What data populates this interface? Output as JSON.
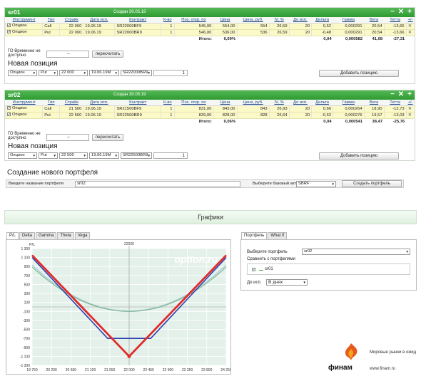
{
  "portfolios": [
    {
      "name": "sr01",
      "created": "Создан 30.05.19",
      "rows": [
        {
          "type": "Опцион",
          "kind": "Call",
          "strike": "22 000",
          "exp": "19.06.19",
          "contract": "SR22000BF9",
          "qty": "1",
          "open": "545,00",
          "price": "554,00",
          "price_rub": "554",
          "iv": "26,59",
          "days": "20",
          "delta": "0,52",
          "gamma": "0,000291",
          "vega": "20,54",
          "theta": "-13,66"
        },
        {
          "type": "Опцион",
          "kind": "Put",
          "strike": "22 000",
          "exp": "19.06.19",
          "contract": "SR22000BR9",
          "qty": "1",
          "open": "546,00",
          "price": "536,00",
          "price_rub": "536",
          "iv": "26,59",
          "days": "20",
          "delta": "-0,48",
          "gamma": "0,000291",
          "vega": "20,54",
          "theta": "-13,66"
        }
      ],
      "total": {
        "label": "Итого:",
        "pct": "0,09%",
        "delta": "0,04",
        "gamma": "0,000582",
        "vega": "41,08",
        "theta": "-27,31"
      },
      "new": {
        "type": "Опцион",
        "kind": "Put",
        "strike": "22 000",
        "exp": "19.06.19М",
        "contract": "SR22000BR9",
        "qty": "1"
      }
    },
    {
      "name": "sr02",
      "created": "Создан 30.05.19",
      "rows": [
        {
          "type": "Опцион",
          "kind": "Call",
          "strike": "21 500",
          "exp": "19.06.19",
          "contract": "SR21500BF9",
          "qty": "1",
          "open": "831,00",
          "price": "843,00",
          "price_rub": "843",
          "iv": "26,93",
          "days": "20",
          "delta": "0,66",
          "gamma": "0,000264",
          "vega": "18,90",
          "theta": "-12,73"
        },
        {
          "type": "Опцион",
          "kind": "Put",
          "strike": "22 500",
          "exp": "19.06.19",
          "contract": "SR22500BR9",
          "qty": "1",
          "open": "839,00",
          "price": "828,00",
          "price_rub": "828",
          "iv": "26,64",
          "days": "20",
          "delta": "-0,62",
          "gamma": "0,000276",
          "vega": "19,57",
          "theta": "-13,03"
        }
      ],
      "total": {
        "label": "Итого:",
        "pct": "0,06%",
        "delta": "0,04",
        "gamma": "0,000541",
        "vega": "38,47",
        "theta": "-25,76"
      },
      "new": {
        "type": "Опцион",
        "kind": "Put",
        "strike": "22 500",
        "exp": "19.06.19М",
        "contract": "SR22500BR9",
        "qty": "1"
      }
    }
  ],
  "headers": [
    "Инструмент",
    "Тип",
    "Страйк",
    "Дата исп.",
    "Контракт",
    "К-во",
    "Поз. откр. по",
    "Цена",
    "Цена, руб.",
    "IV, %",
    "До исп.",
    "Дельта",
    "Гамма",
    "Вега",
    "Тетта",
    "+/-"
  ],
  "go_label": "ГО Временно не доступно",
  "go_value": "--",
  "recalc": "пересчитать",
  "new_position": "Новая позиция",
  "add_position": "Добавить позицию",
  "create": {
    "title": "Создание нового портфеля",
    "name_label": "Введите название портфеля",
    "name_value": "sr02",
    "base_label": "Выберите базовый актив",
    "base_value": "SBRF",
    "button": "Создать портфель"
  },
  "graphs_title": "Графики",
  "chart_tabs": [
    "P/L",
    "Delta",
    "Gamma",
    "Theta",
    "Vega"
  ],
  "side_tabs": [
    "Портфель",
    "What if"
  ],
  "side": {
    "choose_label": "Выберите портфель",
    "choose_value": "sr02",
    "compare_label": "Сравнить с портфелями",
    "compare_item": "sr01",
    "until_label": "До исп.",
    "until_value": "В днях"
  },
  "watermark": "option.ru",
  "finam": {
    "tagline": "Мировые рынки в ожид",
    "brand": "финам",
    "site": "www.finam.ru"
  },
  "colors": {
    "green": "#3aa63c",
    "red": "#e02b2b",
    "blue": "#2c3fb0",
    "row": "#fcf9c8"
  },
  "chart_data": {
    "type": "line",
    "ylabel": "P/L",
    "top_label": "22020",
    "x_ticks": [
      "19 750",
      "20 200",
      "20 650",
      "21 100",
      "21 550",
      "22 000",
      "22 450",
      "22 900",
      "23 350",
      "23 800",
      "24 250"
    ],
    "y_ticks": [
      "1 300",
      "1 100",
      "900",
      "700",
      "500",
      "300",
      "100",
      "-100",
      "-300",
      "-500",
      "-700",
      "-900",
      "-1 100",
      "-1 300"
    ],
    "xlim": [
      19750,
      24250
    ],
    "ylim": [
      -1300,
      1300
    ],
    "series": [
      {
        "name": "sr02",
        "color": "#e02b2b",
        "x": [
          19750,
          22000,
          24250
        ],
        "y": [
          1150,
          -1100,
          1150
        ]
      },
      {
        "name": "sr01",
        "color": "#2c3fb0",
        "x": [
          19750,
          21500,
          22500,
          24250
        ],
        "y": [
          1100,
          -700,
          -700,
          1100
        ]
      },
      {
        "name": "",
        "color": "#7fb88f",
        "x": [
          19750,
          20650,
          21550,
          22000,
          22450,
          23350,
          24250
        ],
        "y": [
          1000,
          300,
          -50,
          -100,
          -50,
          300,
          1000
        ]
      },
      {
        "name": "",
        "color": "#a8c9d8",
        "x": [
          19750,
          20650,
          21550,
          22000,
          22450,
          23350,
          24250
        ],
        "y": [
          1050,
          330,
          -40,
          -90,
          -40,
          330,
          1050
        ]
      }
    ]
  }
}
